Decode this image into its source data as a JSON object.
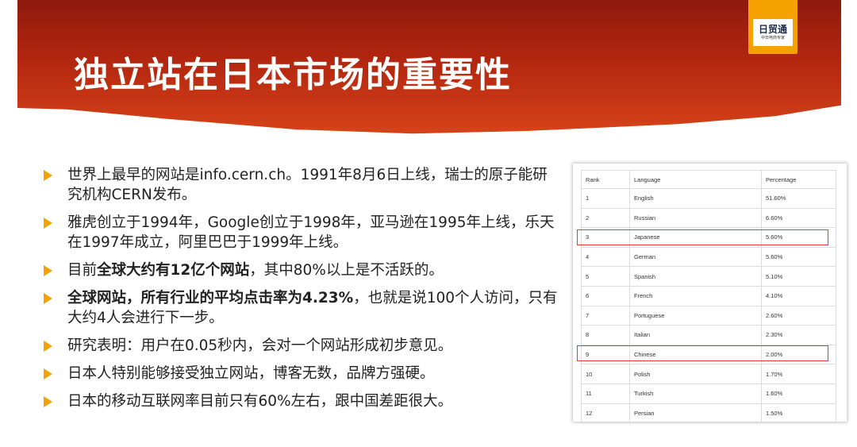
{
  "title": "独立站在日本市场的重要性",
  "logo": {
    "main": "日贸通",
    "sub": "中日电商专家"
  },
  "bullets": [
    {
      "parts": [
        {
          "text": "世界上最早的网站是info.cern.ch。1991年8月6日上线，瑞士的原子能研究机构CERN发布。",
          "bold": false
        }
      ]
    },
    {
      "parts": [
        {
          "text": "雅虎创立于1994年，Google创立于1998年，亚马逊在1995年上线，乐天在1997年成立，阿里巴巴于1999年上线。",
          "bold": false
        }
      ]
    },
    {
      "parts": [
        {
          "text": "目前",
          "bold": false
        },
        {
          "text": "全球大约有12亿个网站",
          "bold": true
        },
        {
          "text": "，其中80%以上是不活跃的。",
          "bold": false
        }
      ]
    },
    {
      "parts": [
        {
          "text": "全球网站，所有行业的平均点击率为4.23%",
          "bold": true
        },
        {
          "text": "，也就是说100个人访问，只有大约4人会进行下一步。",
          "bold": false
        }
      ]
    },
    {
      "parts": [
        {
          "text": "研究表明：用户在0.05秒内，会对一个网站形成初步意见。",
          "bold": false
        }
      ]
    },
    {
      "parts": [
        {
          "text": "日本人特别能够接受独立网站，博客无数，品牌方强硬。",
          "bold": false
        }
      ]
    },
    {
      "parts": [
        {
          "text": "日本的移动互联网率目前只有60%左右，跟中国差距很大。",
          "bold": false
        }
      ]
    }
  ],
  "table": {
    "headers": [
      "Rank",
      "Language",
      "Percentage"
    ],
    "rows": [
      [
        "1",
        "English",
        "51.60%"
      ],
      [
        "2",
        "Russian",
        "6.60%"
      ],
      [
        "3",
        "Japanese",
        "5.60%"
      ],
      [
        "4",
        "German",
        "5.60%"
      ],
      [
        "5",
        "Spanish",
        "5.10%"
      ],
      [
        "6",
        "French",
        "4.10%"
      ],
      [
        "7",
        "Portuguese",
        "2.60%"
      ],
      [
        "8",
        "Italian",
        "2.30%"
      ],
      [
        "9",
        "Chinese",
        "2.00%"
      ],
      [
        "10",
        "Polish",
        "1.70%"
      ],
      [
        "11",
        "Turkish",
        "1.60%"
      ],
      [
        "12",
        "Persian",
        "1.50%"
      ]
    ],
    "highlighted_ranks": [
      "3",
      "9"
    ],
    "highlight_color": "#e53935"
  },
  "colors": {
    "banner": "#b3260f",
    "accent": "#f5a200"
  },
  "icons": {
    "bullet": "triangle-right-icon"
  }
}
